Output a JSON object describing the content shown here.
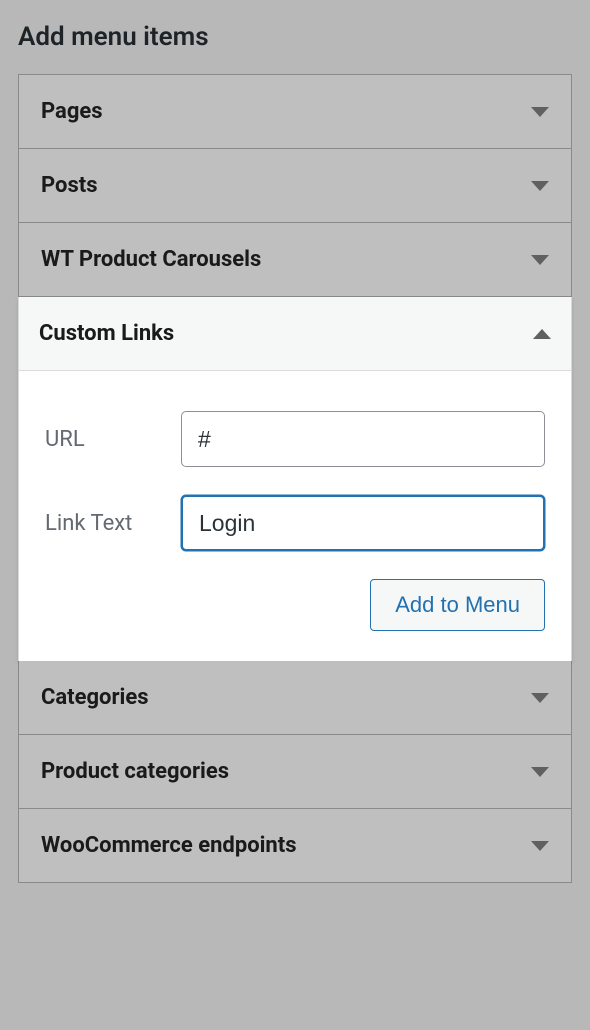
{
  "section_title": "Add menu items",
  "accordion": {
    "pages": {
      "label": "Pages"
    },
    "posts": {
      "label": "Posts"
    },
    "wt_product_carousels": {
      "label": "WT Product Carousels"
    },
    "custom_links": {
      "label": "Custom Links",
      "url_label": "URL",
      "url_value": "#",
      "link_text_label": "Link Text",
      "link_text_value": "Login",
      "add_button_label": "Add to Menu"
    },
    "categories": {
      "label": "Categories"
    },
    "product_categories": {
      "label": "Product categories"
    },
    "woocommerce_endpoints": {
      "label": "WooCommerce endpoints"
    }
  }
}
